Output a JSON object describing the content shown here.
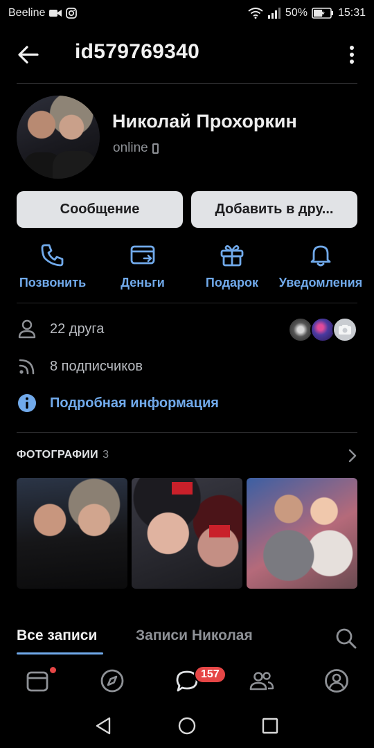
{
  "status_bar": {
    "carrier": "Beeline",
    "battery": "50%",
    "time": "15:31"
  },
  "header": {
    "title": "id579769340"
  },
  "profile": {
    "name": "Николай Прохоркин",
    "status": "online"
  },
  "buttons": {
    "message": "Сообщение",
    "add_friend": "Добавить в дру..."
  },
  "actions": [
    {
      "label": "Позвонить",
      "icon": "phone-icon"
    },
    {
      "label": "Деньги",
      "icon": "money-card-icon"
    },
    {
      "label": "Подарок",
      "icon": "gift-icon"
    },
    {
      "label": "Уведомления",
      "icon": "bell-icon"
    }
  ],
  "info": {
    "friends": "22 друга",
    "followers": "8 подписчиков",
    "details": "Подробная информация"
  },
  "photos": {
    "title": "ФОТОГРАФИИ",
    "count": "3"
  },
  "tabs": {
    "all": "Все записи",
    "own": "Записи Николая"
  },
  "bottom_nav": {
    "messages_badge": "157"
  },
  "colors": {
    "accent": "#71aaeb",
    "background": "#000000",
    "button_bg": "#e1e3e6",
    "badge": "#e64646"
  }
}
